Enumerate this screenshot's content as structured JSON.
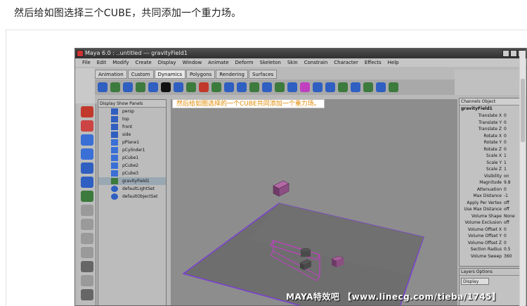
{
  "instruction": "然后给如图选择三个CUBE，共同添加一个重力场。",
  "maya": {
    "title": "Maya 6.0 : ..untitled  ---  gravityField1",
    "menu": [
      "File",
      "Edit",
      "Modify",
      "Create",
      "Display",
      "Window",
      "Animate",
      "Deform",
      "Skeleton",
      "Skin",
      "Constrain",
      "Character",
      "Effects",
      "Help"
    ],
    "shelf_tabs": [
      "Animation",
      "Custom",
      "Dynamics",
      "Polygons",
      "Rendering",
      "Surfaces"
    ],
    "active_shelf_tab": "Dynamics",
    "outliner_menu": "Display  Show  Panels",
    "outliner_items": [
      "persp",
      "top",
      "front",
      "side",
      "pPlane1",
      "pCylinder1",
      "pCube1",
      "pCube2",
      "pCube3",
      "gravityField1",
      "defaultLightSet",
      "defaultObjectSet"
    ],
    "selected_outliner_item": "gravityField1",
    "viewport_label": "然后给如图选择的一个CUBE共同添加一个重力场。",
    "watermark": "MAYA特效吧  【www.linecg.com/tieba/1745】",
    "channel_box": {
      "tabs": "Channels  Object",
      "object": "gravityField1",
      "rows": [
        {
          "name": "Translate X",
          "value": "0"
        },
        {
          "name": "Translate Y",
          "value": "0"
        },
        {
          "name": "Translate Z",
          "value": "0"
        },
        {
          "name": "Rotate X",
          "value": "0"
        },
        {
          "name": "Rotate Y",
          "value": "0"
        },
        {
          "name": "Rotate Z",
          "value": "0"
        },
        {
          "name": "Scale X",
          "value": "1"
        },
        {
          "name": "Scale Y",
          "value": "1"
        },
        {
          "name": "Scale Z",
          "value": "1"
        },
        {
          "name": "Visibility",
          "value": "on"
        },
        {
          "name": "Magnitude",
          "value": "9.8"
        },
        {
          "name": "Attenuation",
          "value": "0"
        },
        {
          "name": "Max Distance",
          "value": "-1"
        },
        {
          "name": "Apply Per Vertex",
          "value": "off"
        },
        {
          "name": "Use Max Distance",
          "value": "off"
        },
        {
          "name": "Volume Shape",
          "value": "None"
        },
        {
          "name": "Volume Exclusion",
          "value": "off"
        },
        {
          "name": "Volume Offset X",
          "value": "0"
        },
        {
          "name": "Volume Offset Y",
          "value": "0"
        },
        {
          "name": "Volume Offset Z",
          "value": "0"
        },
        {
          "name": "Section Radius",
          "value": "0.5"
        },
        {
          "name": "Volume Sweep",
          "value": "360"
        }
      ]
    },
    "layer_editor": {
      "title": "Layers  Options",
      "dropdown": "Display"
    }
  }
}
